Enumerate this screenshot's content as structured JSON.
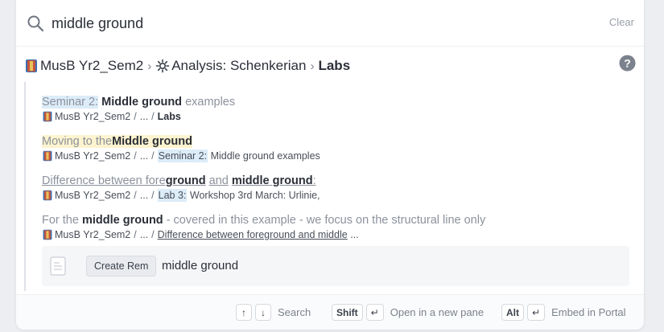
{
  "search": {
    "value": "middle ground",
    "clear_label": "Clear"
  },
  "breadcrumb": {
    "items": [
      "MusB Yr2_Sem2",
      "Analysis: Schenkerian"
    ],
    "current": "Labs",
    "separator": "›"
  },
  "results": [
    {
      "title_parts": {
        "prefix": "Seminar 2:",
        "match": "Middle ground",
        "suffix": "examples"
      },
      "path": {
        "root": "MusB Yr2_Sem2",
        "ellipsis": "...",
        "parent": "Labs"
      }
    },
    {
      "title_parts": {
        "prefix": "Moving to the",
        "match": "Middle ground"
      },
      "path": {
        "root": "MusB Yr2_Sem2",
        "ellipsis": "...",
        "parent_ref": "Seminar 2:",
        "parent_rest": "Middle ground examples"
      }
    },
    {
      "title_parts": {
        "a": "Difference between fore",
        "b": "ground",
        "c": "and",
        "d": "middle ground",
        "e": ":"
      },
      "path": {
        "root": "MusB Yr2_Sem2",
        "ellipsis": "...",
        "parent_ref": "Lab 3:",
        "parent_rest": "Workshop 3rd March: Urlinie,"
      }
    },
    {
      "title_parts": {
        "prefix": "For the",
        "match": "middle ground",
        "suffix": "- covered in this example - we focus on the structural line only"
      },
      "path": {
        "root": "MusB Yr2_Sem2",
        "ellipsis": "...",
        "parent": "Difference between foreground and middle",
        "trailing": "..."
      }
    }
  ],
  "create": {
    "button_label": "Create Rem",
    "text": "middle ground"
  },
  "footer": {
    "up_key": "↑",
    "down_key": "↓",
    "search_label": "Search",
    "shift_key": "Shift",
    "enter_key": "↵",
    "open_label": "Open in a new pane",
    "alt_key": "Alt",
    "embed_label": "Embed in Portal"
  },
  "colors": {
    "accent_highlight": "#dcecf8",
    "yellow_highlight": "#fdf4cf",
    "muted_text": "#8c919c"
  },
  "icons": [
    "search-icon",
    "book-icon",
    "gear-icon",
    "help-icon",
    "document-icon"
  ]
}
